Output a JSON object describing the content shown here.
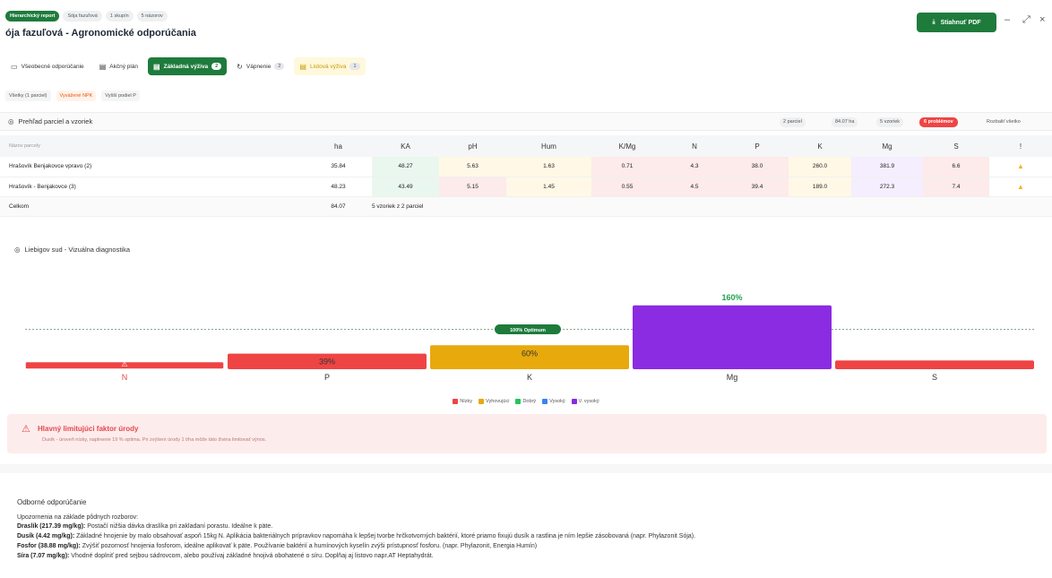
{
  "header": {
    "crumbs": [
      {
        "label": "Hierarchický report",
        "primary": true
      },
      {
        "label": "Sója fazuľová",
        "primary": false
      },
      {
        "label": "1 skupín",
        "primary": false
      },
      {
        "label": "5 názorov",
        "primary": false
      }
    ],
    "title": "ója fazuľová - Agronomické odporúčania",
    "pdf_button": "Stiahnuť PDF",
    "win_minimize": "–",
    "win_expand": "⤢",
    "win_close": "×"
  },
  "tabs": [
    {
      "label": "Všeobecné odporúčanie",
      "icon": "book-icon",
      "count": "",
      "state": "normal"
    },
    {
      "label": "Akčný plán",
      "icon": "clipboard-icon",
      "count": "",
      "state": "normal"
    },
    {
      "label": "Základná výživa",
      "icon": "doc-icon",
      "count": "2",
      "state": "active"
    },
    {
      "label": "Vápnenie",
      "icon": "refresh-icon",
      "count": "2",
      "state": "normal"
    },
    {
      "label": "Listová výživa",
      "icon": "leaf-icon",
      "count": "1",
      "state": "warn"
    }
  ],
  "subfilters": [
    {
      "label": "Všetky (1 parciel)",
      "state": "normal"
    },
    {
      "label": "Vyvážené NPK",
      "state": "warn"
    },
    {
      "label": "Vyšší podiel P",
      "state": "normal"
    }
  ],
  "parcels_panel": {
    "title": "Prehľad parciel a vzoriek",
    "summary": [
      "2 parciel",
      "84.07 ha",
      "5 vzoriek"
    ],
    "problems": "6 problémov",
    "expand_all": "Rozbaliť všetko",
    "columns": [
      "Názov parcely",
      "ha",
      "KA",
      "pH",
      "Hum",
      "K/Mg",
      "N",
      "P",
      "K",
      "Mg",
      "S",
      "!"
    ],
    "rows": [
      {
        "name": "Hrašovík Benjakovce vpravo (2)",
        "ha": "35.84",
        "KA": "48.27",
        "pH": "5.63",
        "Hum": "1.63",
        "KMg": "0.71",
        "N": "4.3",
        "P": "38.0",
        "K": "260.0",
        "Mg": "381.9",
        "S": "6.6"
      },
      {
        "name": "Hrašovík - Benjakovce (3)",
        "ha": "48.23",
        "KA": "43.49",
        "pH": "5.15",
        "Hum": "1.45",
        "KMg": "0.55",
        "N": "4.5",
        "P": "39.4",
        "K": "189.0",
        "Mg": "272.3",
        "S": "7.4"
      }
    ],
    "total": {
      "label": "Celkom",
      "ha": "84.07",
      "note": "5 vzoriek z 2 parciel"
    }
  },
  "liebig": {
    "title": "Liebigov sud - Vizuálna diagnostika",
    "optimum_label": "100% Optimum",
    "colors": {
      "red": "#ef4444",
      "yellow": "#e8a90c",
      "green": "#22c55e",
      "blue": "#3b82f6",
      "purple": "#8b2be2"
    }
  },
  "chart_data": {
    "type": "bar",
    "title": "Liebigov sud - Vizuálna diagnostika",
    "categories": [
      "N",
      "P",
      "K",
      "Mg",
      "S"
    ],
    "values": [
      19,
      39,
      60,
      160,
      22
    ],
    "value_labels": [
      "",
      "39%",
      "60%",
      "160%",
      ""
    ],
    "status": [
      "nizky",
      "nizky",
      "vyhovujuci",
      "v_vysoky",
      "nizky"
    ],
    "reference_line": 100,
    "legend": [
      "Nízky",
      "Vyhovujúci",
      "Dobrý",
      "Vysoký",
      "V. vysoký"
    ],
    "legend_colors": [
      "#ef4444",
      "#e8a90c",
      "#22c55e",
      "#3b82f6",
      "#8b2be2"
    ]
  },
  "alert": {
    "title": "Hlavný limitujúci faktor úrody",
    "text": "Dusík - úroveň nízky, naplnenie 19 % optima. Pri zvýšení úrody 1 t/ha môže táto živina limitovať výnos."
  },
  "recommendation": {
    "heading": "Odborné odporúčanie",
    "subheading": "Upozornenia na základe pôdnych rozborov:",
    "items": [
      {
        "label": "Draslík (217.39 mg/kg):",
        "text": " Postačí nižšia dávka draslíka pri zakladaní porastu. Ideálne k päte."
      },
      {
        "label": "Dusík (4.42 mg/kg):",
        "text": " Základné hnojenie by malo obsahovať aspoň 15kg N. Aplikácia bakteriálnych prípravkov napomáha k lepšej tvorbe hrčkotvorných baktérií, ktoré priamo fixujú dusík a rastlina je ním lepšie zásobovaná (napr. Phylazonit Sója)."
      },
      {
        "label": "Fosfor (38.88 mg/kg):",
        "text": " Zvýšiť pozornosť hnojenia fosforom, ideálne aplikovať k päte. Používanie baktérií a humínových kyselín zvýši prístupnosť fosforu. (napr. Phylazonit, Energia Humín)"
      },
      {
        "label": "Síra (7.07 mg/kg):",
        "text": " Vhodné doplniť pred sejbou sádrovcom, alebo používaj základné hnojivá obohatené o síru. Doplňaj aj listovo napr.AT Heptahydrát."
      }
    ]
  }
}
